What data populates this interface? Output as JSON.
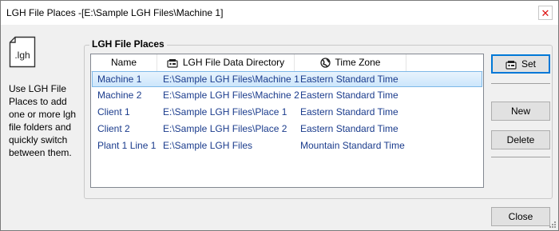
{
  "window": {
    "title": "LGH File Places -[E:\\Sample LGH Files\\Machine 1]",
    "close_glyph": "✕"
  },
  "left": {
    "icon_label": ".lgh",
    "description": "Use LGH File Places to add one or more lgh file folders and quickly switch between them."
  },
  "group": {
    "title": "LGH File Places"
  },
  "list": {
    "columns": [
      "Name",
      "LGH File Data Directory",
      "Time Zone"
    ],
    "rows": [
      {
        "name": "Machine 1",
        "dir": "E:\\Sample LGH Files\\Machine 1",
        "tz": "Eastern Standard Time",
        "selected": true
      },
      {
        "name": "Machine 2",
        "dir": "E:\\Sample LGH Files\\Machine 2",
        "tz": "Eastern Standard Time"
      },
      {
        "name": "Client 1",
        "dir": "E:\\Sample LGH Files\\Place 1",
        "tz": "Eastern Standard Time"
      },
      {
        "name": "Client 2",
        "dir": "E:\\Sample LGH Files\\Place 2",
        "tz": "Eastern Standard Time"
      },
      {
        "name": "Plant 1 Line 1",
        "dir": "E:\\Sample LGH Files",
        "tz": "Mountain Standard Time"
      }
    ]
  },
  "buttons": {
    "set": "Set",
    "new": "New",
    "delete": "Delete",
    "close": "Close"
  },
  "icons": {
    "folder": "folder-file-icon",
    "directory": "data-directory-icon",
    "timezone": "globe-icon",
    "set": "set-icon"
  },
  "colors": {
    "row_text": "#1a3b8c",
    "selection": "#cce6fb",
    "selection_border": "#7db8e8",
    "default_button_border": "#0078d7"
  }
}
